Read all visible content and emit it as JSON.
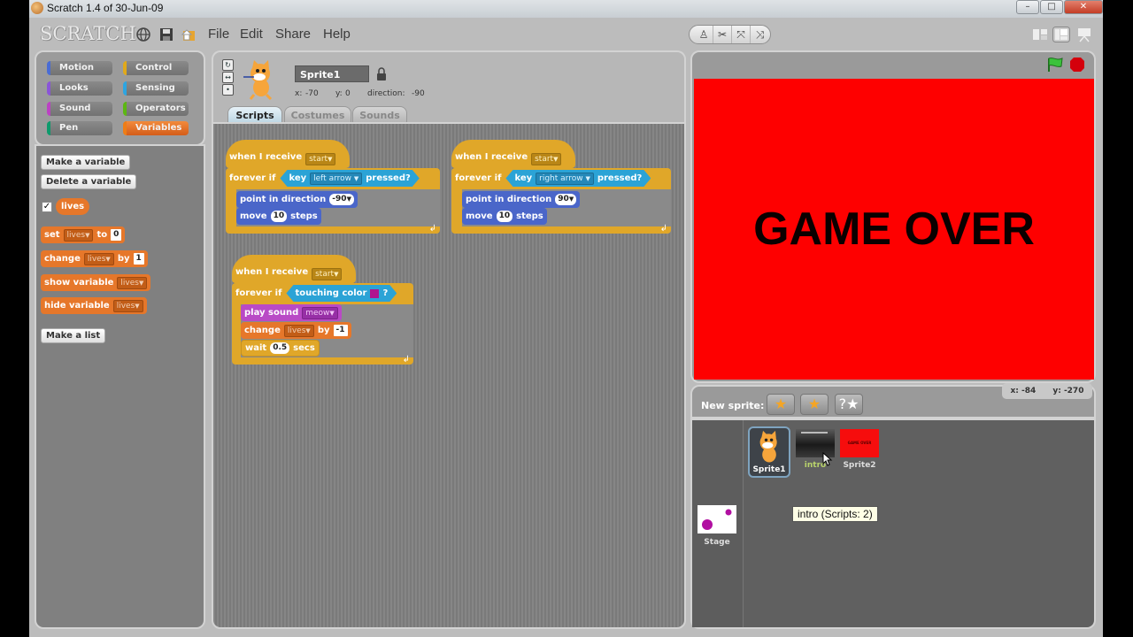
{
  "window": {
    "title": "Scratch 1.4 of 30-Jun-09",
    "minimize_label": "–",
    "maximize_label": "□",
    "close_label": "✕"
  },
  "menubar": {
    "logo": "SCRATCH",
    "icons": [
      "globe-icon",
      "save-icon",
      "share-folder-icon"
    ],
    "items": [
      "File",
      "Edit",
      "Share",
      "Help"
    ],
    "tools": [
      "duplicate-stamp-icon",
      "delete-scissors-icon",
      "grow-icon",
      "shrink-icon"
    ],
    "tool_glyphs": [
      "♙",
      "✂",
      "⤧",
      "⤨"
    ],
    "view_modes": [
      "small-stage-view",
      "normal-stage-view",
      "presentation-mode"
    ]
  },
  "palette": {
    "categories": [
      {
        "label": "Motion",
        "color": "#4a6cd4"
      },
      {
        "label": "Control",
        "color": "#e1a91a"
      },
      {
        "label": "Looks",
        "color": "#8a55d7"
      },
      {
        "label": "Sensing",
        "color": "#2ca5e2"
      },
      {
        "label": "Sound",
        "color": "#bb42c3"
      },
      {
        "label": "Operators",
        "color": "#5cb712"
      },
      {
        "label": "Pen",
        "color": "#0e9a6c"
      },
      {
        "label": "Variables",
        "color": "#ee7d16"
      }
    ],
    "active_category": "Variables",
    "make_variable": "Make a variable",
    "delete_variable": "Delete a variable",
    "variable_name": "lives",
    "variable_checked": true,
    "blocks": {
      "set": {
        "label": "set",
        "var": "lives",
        "to": "to",
        "value": "0"
      },
      "change": {
        "label": "change",
        "var": "lives",
        "by": "by",
        "value": "1"
      },
      "show": {
        "label": "show variable",
        "var": "lives"
      },
      "hide": {
        "label": "hide variable",
        "var": "lives"
      }
    },
    "make_list": "Make a list"
  },
  "sprite": {
    "name": "Sprite1",
    "x_label": "x:",
    "x": "-70",
    "y_label": "y:",
    "y": "0",
    "direction_label": "direction:",
    "direction": "-90",
    "tabs": [
      "Scripts",
      "Costumes",
      "Sounds"
    ],
    "active_tab": "Scripts"
  },
  "scripts": [
    {
      "hat": "when I receive",
      "message": "start",
      "loop": "forever if",
      "cond_key": "key",
      "cond_value": "left arrow",
      "cond_pressed": "pressed?",
      "b1": "point in direction",
      "b1_value": "-90",
      "b2": "move",
      "b2_value": "10",
      "b2_suffix": "steps"
    },
    {
      "hat": "when I receive",
      "message": "start",
      "loop": "forever if",
      "cond_key": "key",
      "cond_value": "right arrow",
      "cond_pressed": "pressed?",
      "b1": "point in direction",
      "b1_value": "90",
      "b2": "move",
      "b2_value": "10",
      "b2_suffix": "steps"
    },
    {
      "hat": "when I receive",
      "message": "start",
      "loop": "forever if",
      "cond": "touching color",
      "cond_color": "#b0148f",
      "cond_q": "?",
      "b1": "play sound",
      "b1_value": "meow",
      "b2": "change",
      "b2_var": "lives",
      "b2_by": "by",
      "b2_value": "-1",
      "b3": "wait",
      "b3_value": "0.5",
      "b3_suffix": "secs"
    }
  ],
  "stage": {
    "text": "GAME OVER",
    "background": "#fe0000",
    "mouse_x_label": "x:",
    "mouse_x": "-84",
    "mouse_y_label": "y:",
    "mouse_y": "-270"
  },
  "sprite_list": {
    "new_sprite_label": "New sprite:",
    "new_sprite_buttons": [
      "paint-new-sprite",
      "choose-sprite-from-file",
      "surprise-sprite"
    ],
    "sprites": [
      {
        "name": "Sprite1",
        "selected": true
      },
      {
        "name": "intro",
        "selected": false
      },
      {
        "name": "Sprite2",
        "selected": false
      }
    ],
    "stage_label": "Stage",
    "tooltip": "intro (Scripts: 2)",
    "sprite2_thumb_text": "GAME OVER"
  }
}
